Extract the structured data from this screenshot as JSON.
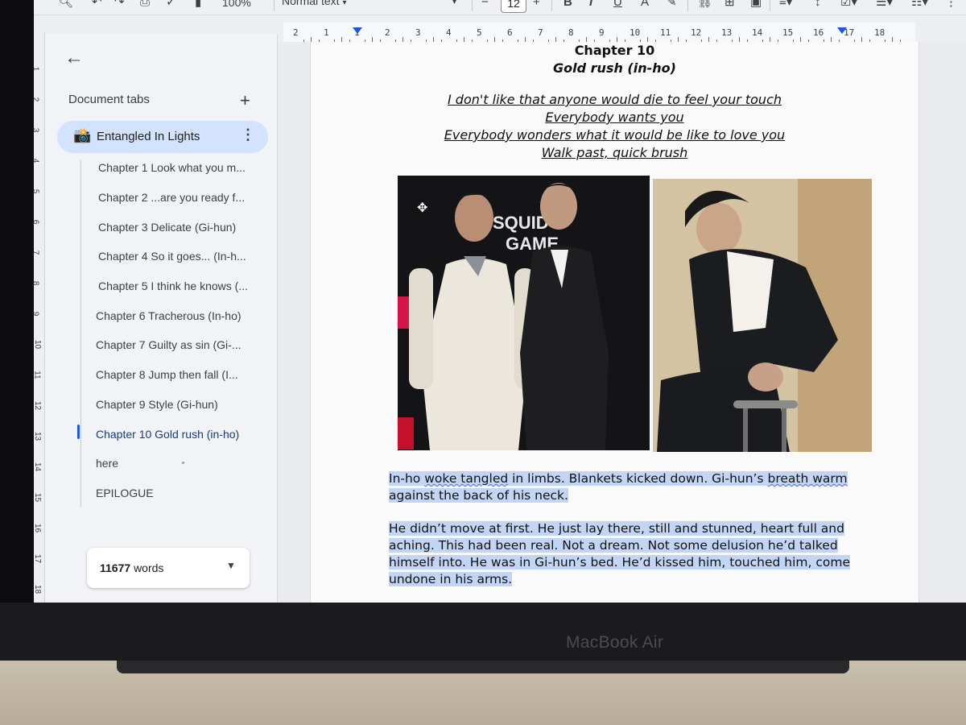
{
  "toolbar": {
    "zoom": "100%",
    "style": "Normal text",
    "font_size": "12",
    "minus": "−",
    "plus": "+",
    "bold": "B",
    "italic": "I",
    "underline": "U",
    "text_color": "A"
  },
  "ruler": {
    "numbers": [
      "2",
      "1",
      "1",
      "2",
      "3",
      "4",
      "5",
      "6",
      "7",
      "8",
      "9",
      "10",
      "11",
      "12",
      "13",
      "14",
      "15",
      "16",
      "17",
      "18"
    ]
  },
  "vertical_ruler": {
    "numbers": [
      "1",
      "2",
      "3",
      "4",
      "5",
      "6",
      "7",
      "8",
      "9",
      "10",
      "11",
      "12",
      "13",
      "14",
      "15",
      "16",
      "17",
      "18"
    ]
  },
  "sidebar": {
    "title": "Document tabs",
    "add": "+",
    "active_tab": {
      "emoji": "📸",
      "label": "Entangled In Lights"
    },
    "items": [
      {
        "label": "Chapter 1 Look what you m..."
      },
      {
        "label": "Chapter 2 ...are you ready f..."
      },
      {
        "label": "Chapter 3 Delicate (Gi-hun)"
      },
      {
        "label": "Chapter 4 So it goes... (In-h..."
      },
      {
        "label": "Chapter 5 I think he knows (..."
      },
      {
        "label": "Chapter 6 Tracherous (In-ho)"
      },
      {
        "label": "Chapter 7 Guilty as sin (Gi-..."
      },
      {
        "label": "Chapter 8 Jump then fall (I..."
      },
      {
        "label": "Chapter 9 Style (Gi-hun)"
      },
      {
        "label": "Chapter 10 Gold rush (in-ho)"
      },
      {
        "label": "here"
      },
      {
        "label": "EPILOGUE"
      }
    ],
    "word_count": {
      "number": "11677",
      "unit": "words"
    }
  },
  "document": {
    "title": "Chapter 10",
    "subtitle": "Gold rush (in-ho)",
    "lyrics": [
      "I don't like that anyone would die to feel your touch",
      "Everybody wants you",
      "Everybody wonders what it would be like to love you",
      "Walk past, quick brush"
    ],
    "images": {
      "left_text_1": "SQUID",
      "left_text_2": "GAME"
    },
    "paragraph1": {
      "part1": "In-ho ",
      "word1": "woke tangled",
      "part2": " in limbs. Blankets kicked down. Gi-hun’s ",
      "word2": "breath warm",
      "part3": " against the back of his neck."
    },
    "paragraph2": "He didn’t move at first. He just lay there, still and stunned, heart full and aching. This had been real. Not a dream. Not some delusion he’d talked himself into. He was in Gi-hun’s bed. He’d kissed him, touched him, come undone in his arms."
  },
  "device": {
    "brand": "MacBook Air"
  }
}
